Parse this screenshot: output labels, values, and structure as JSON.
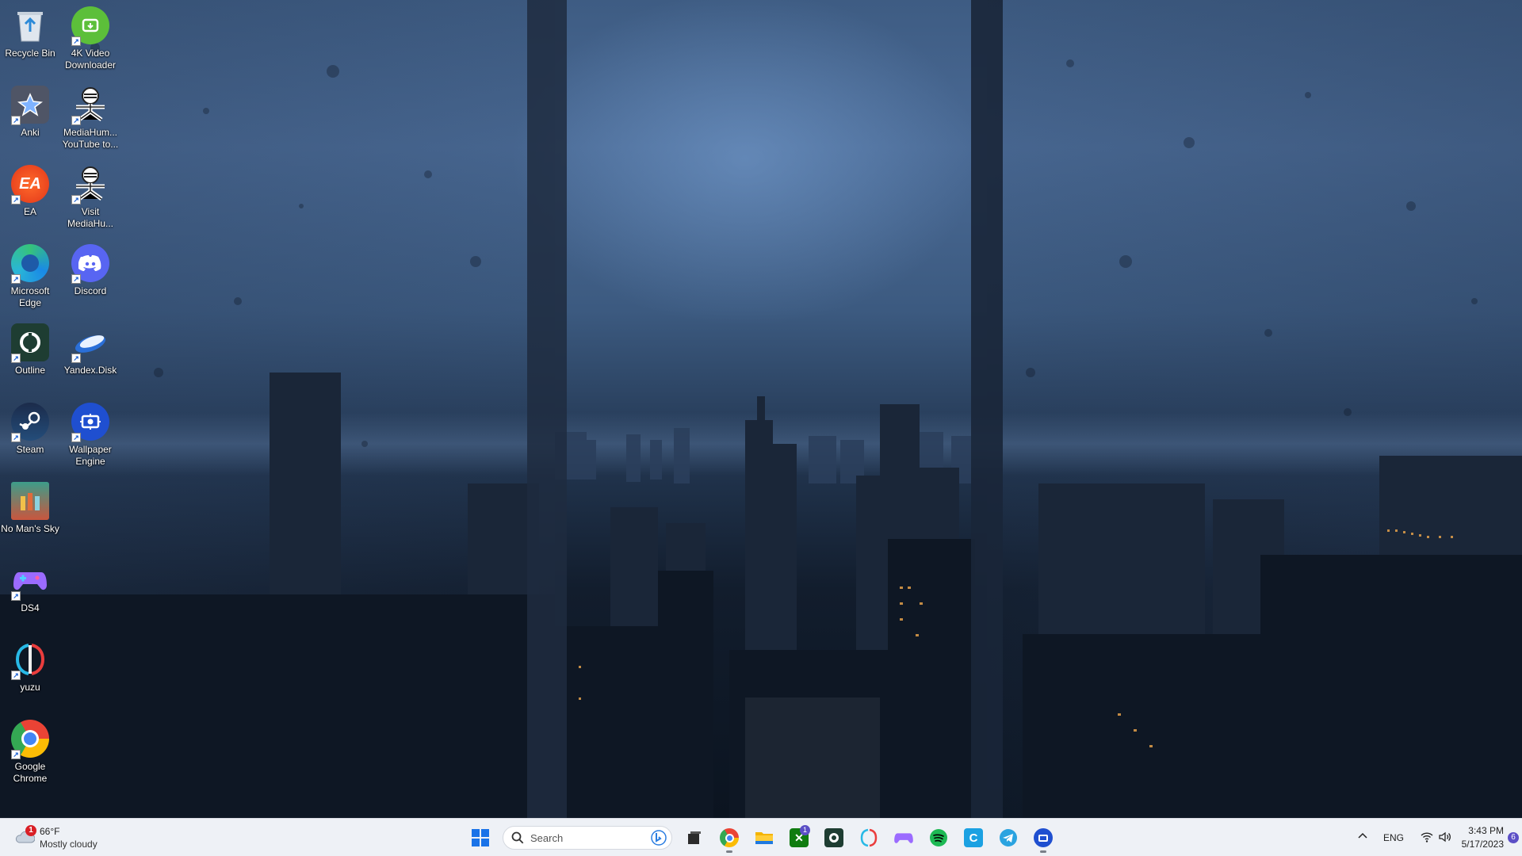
{
  "desktop": {
    "icons": [
      {
        "label": "Recycle Bin",
        "icon": "recycle-bin-icon"
      },
      {
        "label": "4K Video Downloader",
        "icon": "4k-video-downloader-icon"
      },
      {
        "label": "Anki",
        "icon": "anki-icon"
      },
      {
        "label": "MediaHum... YouTube to...",
        "icon": "mediahuman-icon"
      },
      {
        "label": "EA",
        "icon": "ea-icon"
      },
      {
        "label": "Visit MediaHu...",
        "icon": "mediahuman-icon"
      },
      {
        "label": "Microsoft Edge",
        "icon": "edge-icon"
      },
      {
        "label": "Discord",
        "icon": "discord-icon"
      },
      {
        "label": "Outline",
        "icon": "outline-icon"
      },
      {
        "label": "Yandex.Disk",
        "icon": "yandex-disk-icon"
      },
      {
        "label": "Steam",
        "icon": "steam-icon"
      },
      {
        "label": "Wallpaper Engine",
        "icon": "wallpaper-engine-icon"
      },
      {
        "label": "No Man's Sky",
        "icon": "no-mans-sky-icon"
      },
      {
        "label": "DS4",
        "icon": "gamepad-icon"
      },
      {
        "label": "yuzu",
        "icon": "yuzu-icon"
      },
      {
        "label": "Google Chrome",
        "icon": "chrome-icon"
      }
    ]
  },
  "taskbar": {
    "weather": {
      "temp": "66°F",
      "condition": "Mostly cloudy",
      "badge": "1"
    },
    "search": {
      "placeholder": "Search"
    },
    "apps": [
      {
        "name": "task-view",
        "icon": "task-view-icon"
      },
      {
        "name": "chrome",
        "icon": "chrome-icon"
      },
      {
        "name": "file-explorer",
        "icon": "folder-icon"
      },
      {
        "name": "xbox",
        "icon": "xbox-icon",
        "badge": "1"
      },
      {
        "name": "outline",
        "icon": "outline-icon"
      },
      {
        "name": "yuzu",
        "icon": "yuzu-icon"
      },
      {
        "name": "ds4",
        "icon": "gamepad-icon"
      },
      {
        "name": "spotify",
        "icon": "spotify-icon"
      },
      {
        "name": "ccleaner",
        "icon": "ccleaner-icon"
      },
      {
        "name": "telegram",
        "icon": "telegram-icon"
      },
      {
        "name": "wallpaper-engine",
        "icon": "wallpaper-engine-icon"
      }
    ],
    "tray": {
      "language": "ENG",
      "time": "3:43 PM",
      "date": "5/17/2023",
      "notifications": "6"
    }
  }
}
